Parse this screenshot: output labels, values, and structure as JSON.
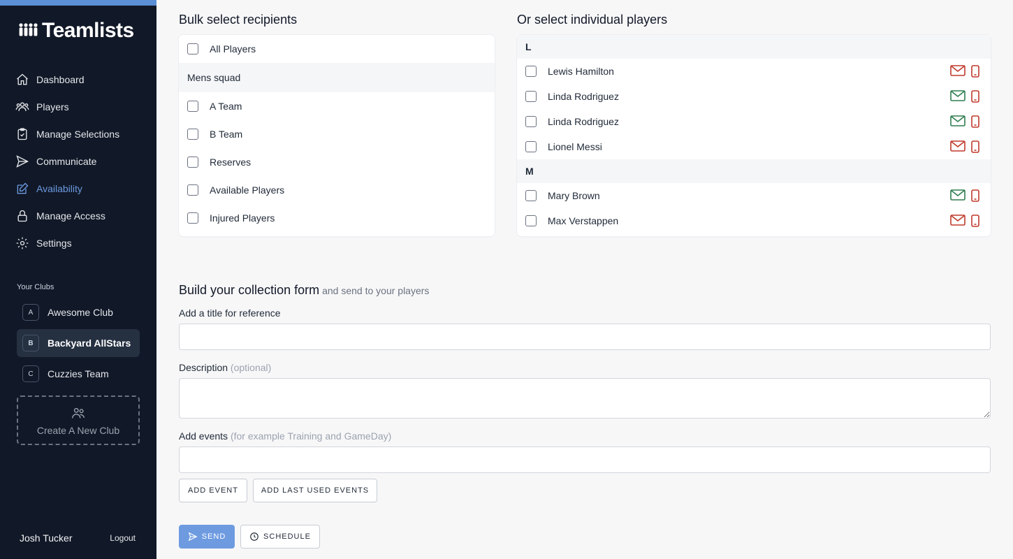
{
  "app": {
    "logo_text": "Teamlists"
  },
  "sidebar": {
    "nav": [
      {
        "label": "Dashboard",
        "icon": "home-icon"
      },
      {
        "label": "Players",
        "icon": "users-icon"
      },
      {
        "label": "Manage Selections",
        "icon": "clipboard-check-icon"
      },
      {
        "label": "Communicate",
        "icon": "send-icon"
      },
      {
        "label": "Availability",
        "icon": "edit-icon",
        "active": true
      },
      {
        "label": "Manage Access",
        "icon": "lock-icon"
      },
      {
        "label": "Settings",
        "icon": "gear-icon"
      }
    ],
    "clubs_label": "Your Clubs",
    "clubs": [
      {
        "badge": "A",
        "name": "Awesome Club"
      },
      {
        "badge": "B",
        "name": "Backyard AllStars",
        "active": true
      },
      {
        "badge": "C",
        "name": "Cuzzies Team"
      }
    ],
    "new_club_label": "Create A New Club",
    "user_name": "Josh Tucker",
    "logout_label": "Logout"
  },
  "bulk": {
    "title": "Bulk select recipients",
    "all_label": "All Players",
    "group_label": "Mens squad",
    "items": [
      "A Team",
      "B Team",
      "Reserves",
      "Available Players",
      "Injured Players"
    ]
  },
  "individual": {
    "title": "Or select individual players",
    "groups": [
      {
        "letter": "L",
        "players": [
          {
            "name": "Lewis Hamilton",
            "email_color": "#c0392b",
            "phone_color": "#c0392b"
          },
          {
            "name": "Linda Rodriguez",
            "email_color": "#2e7d4f",
            "phone_color": "#c0392b"
          },
          {
            "name": "Linda Rodriguez",
            "email_color": "#2e7d4f",
            "phone_color": "#c0392b"
          },
          {
            "name": "Lionel Messi",
            "email_color": "#c0392b",
            "phone_color": "#c0392b"
          }
        ]
      },
      {
        "letter": "M",
        "players": [
          {
            "name": "Mary Brown",
            "email_color": "#2e7d4f",
            "phone_color": "#c0392b"
          },
          {
            "name": "Max Verstappen",
            "email_color": "#c0392b",
            "phone_color": "#c0392b"
          }
        ]
      }
    ]
  },
  "form": {
    "heading": "Build your collection form",
    "heading_sub": "and send to your players",
    "title_label": "Add a title for reference",
    "title_value": "",
    "description_label": "Description",
    "description_hint": "(optional)",
    "description_value": "",
    "events_label": "Add events",
    "events_hint": "(for example Training and GameDay)",
    "events_value": "",
    "add_event": "ADD EVENT",
    "add_last_events": "ADD LAST USED EVENTS",
    "send": "SEND",
    "schedule": "SCHEDULE"
  }
}
